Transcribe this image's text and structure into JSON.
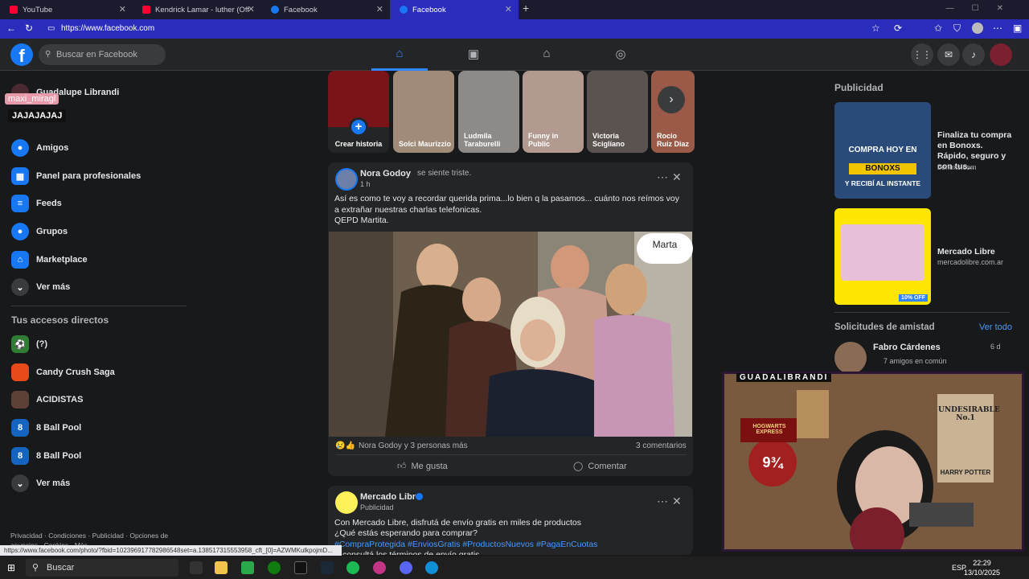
{
  "browser": {
    "tabs": [
      {
        "label": "YouTube",
        "color": "#ff0033"
      },
      {
        "label": "Kendrick Lamar - luther (Off",
        "color": "#ff0033"
      },
      {
        "label": "Facebook",
        "color": "#1877f2"
      },
      {
        "label": "Facebook",
        "color": "#1877f2"
      }
    ],
    "url": "https://www.facebook.com"
  },
  "header": {
    "search_placeholder": "Buscar en Facebook"
  },
  "sidebar": {
    "profile_name": "Guadalupe Librandi",
    "items": [
      {
        "label": "Amigos",
        "color": "#1877f2"
      },
      {
        "label": "Panel para profesionales",
        "color": "#1877f2"
      },
      {
        "label": "Feeds",
        "color": "#1877f2"
      },
      {
        "label": "Grupos",
        "color": "#1877f2"
      },
      {
        "label": "Marketplace",
        "color": "#1877f2"
      },
      {
        "label": "Ver más",
        "color": "#3a3b3c"
      }
    ],
    "shortcuts_title": "Tus accesos directos",
    "shortcuts": [
      {
        "label": "(?)",
        "color": "#2e7d32"
      },
      {
        "label": "Candy Crush Saga",
        "color": "#e64a19"
      },
      {
        "label": "ACIDISTAS",
        "color": "#5d4037"
      },
      {
        "label": "8 Ball Pool",
        "color": "#1565c0"
      },
      {
        "label": "8 Ball Pool",
        "color": "#1565c0"
      },
      {
        "label": "Ver más",
        "color": "#3a3b3c"
      }
    ],
    "footer": "Privacidad · Condiciones · Publicidad · Opciones de anuncios · Cookies · Más"
  },
  "overlay": {
    "name_tag": "maxi_miragl",
    "laugh_text": "JAJAJAJAJ"
  },
  "stories": [
    {
      "name": "Crear historia",
      "color": "#7a1418"
    },
    {
      "name": "Solci Maurizzio",
      "color": "#a08a78"
    },
    {
      "name": "Ludmila Taraburelli",
      "color": "#8d8a88"
    },
    {
      "name": "Funny in Public",
      "color": "#b39a90"
    },
    {
      "name": "Victoria Sciglíano",
      "color": "#5b5350"
    },
    {
      "name": "Rocio Ruiz Diaz",
      "color": "#9b5a48"
    }
  ],
  "post1": {
    "author": "Nora Godoy",
    "feeling": "se siente triste.",
    "time": "1 h",
    "text": "Así es como te voy a recordar querida prima...lo bien q la pasamos... cuánto nos reímos  voy a extrañar nuestras charlas telefonicas.\nQEPD Martita.",
    "photo_tag": "Marta",
    "reactions": "Nora Godoy y 3 personas más",
    "comments": "3 comentarios",
    "like_label": "Me gusta",
    "comment_label": "Comentar"
  },
  "post2": {
    "author": "Mercado Libre",
    "meta": "Publicidad",
    "line1": "Con Mercado Libre, disfrutá de envío gratis en miles de productos",
    "line2": "¿Qué estás esperando para comprar?",
    "tags": "#CompraProtegida #EnviosGratis #ProductosNuevos #PagaEnCuotas",
    "line4": "consultá los términos de envío gratis"
  },
  "right": {
    "ads_title": "Publicidad",
    "ad1": {
      "title": "Finaliza tu compra en Bonoxs. Rápido, seguro y con tus...",
      "site": "bonoxs.com",
      "banner1": "COMPRA HOY EN",
      "banner2": "BONOXS",
      "banner3": "Y RECIBÍ AL INSTANTE"
    },
    "ad2": {
      "title": "Mercado Libre",
      "site": "mercadolibre.com.ar",
      "badge": "10% OFF"
    },
    "requests_title": "Solicitudes de amistad",
    "see_all": "Ver todo",
    "request": {
      "name": "Fabro Cárdenes",
      "mutual": "7 amigos en común",
      "age": "6 d"
    }
  },
  "webcam": {
    "label": "GUADALIBRANDI",
    "poster": "UNDESIRABLE No.1",
    "poster_name": "HARRY POTTER",
    "sign_top": "HOGWARTS EXPRESS",
    "platform": "9¾"
  },
  "status_url": "https://www.facebook.com/photo/?fbid=102396917782986548set=a.138517315553958_cft_[0]=AZWMKulkpojmD...",
  "taskbar": {
    "search": "Buscar",
    "lang": "ESP",
    "time": "22:29",
    "date": "13/10/2025"
  }
}
